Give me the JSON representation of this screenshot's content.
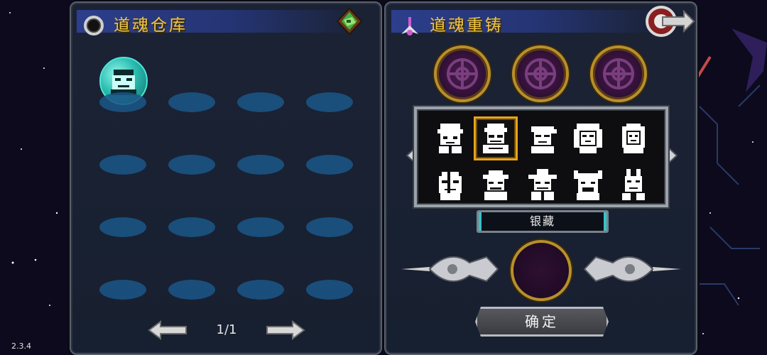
{
  "version": "2.3.4",
  "left_panel": {
    "title": "道魂仓库",
    "pagination": {
      "page": "1/1"
    }
  },
  "right_panel": {
    "title": "道魂重铸",
    "selected_name": "银藏",
    "confirm_label": "确定"
  },
  "colors": {
    "title_gold": "#f2c640",
    "slot_blue": "#1b5688",
    "socket_gold": "#b8902a",
    "select_orange": "#e8a418",
    "cyan_accent": "#37c2c8"
  },
  "icons": {
    "ring": "ring-icon",
    "gem": "gem-icon",
    "star": "star-icon",
    "exit": "exit-icon",
    "prev": "arrow-left-icon",
    "next": "arrow-right-icon"
  }
}
